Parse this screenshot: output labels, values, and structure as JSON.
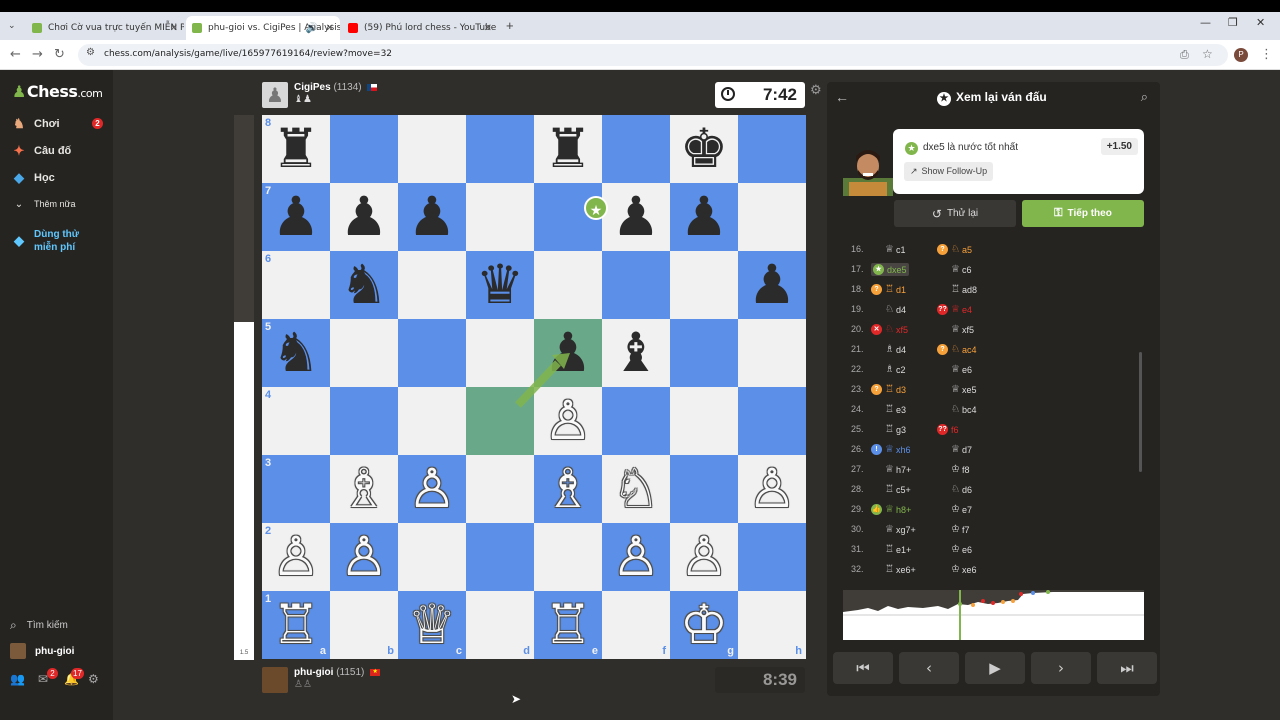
{
  "browser": {
    "tabs": [
      {
        "title": "Chơi Cờ vua trực tuyến MIỄN PHÍ",
        "favicon_color": "#81b64c",
        "active": false
      },
      {
        "title": "phu-gioi vs. CigiPes | Analysis",
        "favicon_color": "#81b64c",
        "active": true
      },
      {
        "title": "(59) Phú lord chess - YouTube",
        "favicon_color": "#ff0000",
        "active": false
      }
    ],
    "url": "chess.com/analysis/game/live/165977619164/review?move=32",
    "new_tab": "+",
    "profile_initial": "P"
  },
  "sidebar": {
    "logo_main": "Chess",
    "logo_suffix": ".com",
    "items": [
      {
        "label": "Chơi",
        "icon": "play-icon",
        "badge": "2"
      },
      {
        "label": "Câu đố",
        "icon": "puzzle-icon"
      },
      {
        "label": "Học",
        "icon": "learn-icon"
      },
      {
        "label": "Thêm nữa",
        "icon": "chevron-down-icon"
      }
    ],
    "trial_line1": "Dùng thử",
    "trial_line2": "miễn phí",
    "search_label": "Tìm kiếm",
    "username": "phu-gioi",
    "mail_badge": "2",
    "bell_badge": "17"
  },
  "players": {
    "top": {
      "name": "CigiPes",
      "rating": "(1134)",
      "captured": "♝♟",
      "clock": "7:42"
    },
    "bottom": {
      "name": "phu-gioi",
      "rating": "(1151)",
      "captured": "♙♙",
      "clock": "8:39"
    }
  },
  "eval_bar": {
    "label": "1.5",
    "white_fraction": 0.62
  },
  "board": {
    "files": [
      "a",
      "b",
      "c",
      "d",
      "e",
      "f",
      "g",
      "h"
    ],
    "ranks": [
      "8",
      "7",
      "6",
      "5",
      "4",
      "3",
      "2",
      "1"
    ],
    "highlight_from": "d4",
    "highlight_to": "e5",
    "pieces": [
      {
        "sq": "a8",
        "p": "♜",
        "c": "b"
      },
      {
        "sq": "e8",
        "p": "♜",
        "c": "b"
      },
      {
        "sq": "g8",
        "p": "♚",
        "c": "b"
      },
      {
        "sq": "a7",
        "p": "♟",
        "c": "b"
      },
      {
        "sq": "b7",
        "p": "♟",
        "c": "b"
      },
      {
        "sq": "c7",
        "p": "♟",
        "c": "b"
      },
      {
        "sq": "f7",
        "p": "♟",
        "c": "b"
      },
      {
        "sq": "g7",
        "p": "♟",
        "c": "b"
      },
      {
        "sq": "b6",
        "p": "♞",
        "c": "b"
      },
      {
        "sq": "d6",
        "p": "♛",
        "c": "b"
      },
      {
        "sq": "h6",
        "p": "♟",
        "c": "b"
      },
      {
        "sq": "a5",
        "p": "♞",
        "c": "b"
      },
      {
        "sq": "e5",
        "p": "♟",
        "c": "b"
      },
      {
        "sq": "f5",
        "p": "♝",
        "c": "b"
      },
      {
        "sq": "e4",
        "p": "♙",
        "c": "w"
      },
      {
        "sq": "b3",
        "p": "♗",
        "c": "w"
      },
      {
        "sq": "c3",
        "p": "♙",
        "c": "w"
      },
      {
        "sq": "e3",
        "p": "♗",
        "c": "w"
      },
      {
        "sq": "f3",
        "p": "♘",
        "c": "w"
      },
      {
        "sq": "h3",
        "p": "♙",
        "c": "w"
      },
      {
        "sq": "a2",
        "p": "♙",
        "c": "w"
      },
      {
        "sq": "b2",
        "p": "♙",
        "c": "w"
      },
      {
        "sq": "f2",
        "p": "♙",
        "c": "w"
      },
      {
        "sq": "g2",
        "p": "♙",
        "c": "w"
      },
      {
        "sq": "a1",
        "p": "♖",
        "c": "w"
      },
      {
        "sq": "c1",
        "p": "♕",
        "c": "w"
      },
      {
        "sq": "e1",
        "p": "♖",
        "c": "w"
      },
      {
        "sq": "g1",
        "p": "♔",
        "c": "w"
      }
    ],
    "light_color": "#f1f1f1",
    "dark_color": "#5b8fe8"
  },
  "review": {
    "title": "Xem lại ván đấu",
    "best_move_text": "dxe5 là nước tốt nhất",
    "eval": "+1.50",
    "follow_up": "Show Follow-Up",
    "retry": "Thử lại",
    "next": "Tiếp theo"
  },
  "moves": [
    {
      "n": "16.",
      "w": {
        "pc": "♕",
        "m": "c1"
      },
      "b": {
        "pc": "♘",
        "m": "a5",
        "ann": "?",
        "annc": "#f7a13a",
        "col": "#f7a13a"
      }
    },
    {
      "n": "17.",
      "w": {
        "m": "dxe5",
        "ann": "★",
        "annc": "#81b64c",
        "current": true,
        "col": "#81b64c"
      },
      "b": {
        "pc": "♕",
        "m": "c6"
      }
    },
    {
      "n": "18.",
      "w": {
        "pc": "♖",
        "m": "d1",
        "ann": "?",
        "annc": "#f7a13a",
        "col": "#f7a13a"
      },
      "b": {
        "pc": "♖",
        "m": "ad8"
      }
    },
    {
      "n": "19.",
      "w": {
        "pc": "♘",
        "m": "d4"
      },
      "b": {
        "pc": "♕",
        "m": "e4",
        "ann": "??",
        "annc": "#e02828",
        "col": "#e02828"
      }
    },
    {
      "n": "20.",
      "w": {
        "pc": "♘",
        "m": "xf5",
        "ann": "✕",
        "annc": "#e02828",
        "col": "#e02828"
      },
      "b": {
        "pc": "♕",
        "m": "xf5"
      }
    },
    {
      "n": "21.",
      "w": {
        "pc": "♗",
        "m": "d4"
      },
      "b": {
        "pc": "♘",
        "m": "ac4",
        "ann": "?",
        "annc": "#f7a13a",
        "col": "#f7a13a"
      }
    },
    {
      "n": "22.",
      "w": {
        "pc": "♗",
        "m": "c2"
      },
      "b": {
        "pc": "♕",
        "m": "e6"
      }
    },
    {
      "n": "23.",
      "w": {
        "pc": "♖",
        "m": "d3",
        "ann": "?",
        "annc": "#f7a13a",
        "col": "#f7a13a"
      },
      "b": {
        "pc": "♕",
        "m": "xe5"
      }
    },
    {
      "n": "24.",
      "w": {
        "pc": "♖",
        "m": "e3"
      },
      "b": {
        "pc": "♘",
        "m": "bc4"
      }
    },
    {
      "n": "25.",
      "w": {
        "pc": "♖",
        "m": "g3"
      },
      "b": {
        "m": "f6",
        "ann": "??",
        "annc": "#e02828",
        "col": "#e02828"
      }
    },
    {
      "n": "26.",
      "w": {
        "pc": "♕",
        "m": "xh6",
        "ann": "!",
        "annc": "#5b8fe8",
        "col": "#5b8fe8"
      },
      "b": {
        "pc": "♕",
        "m": "d7"
      }
    },
    {
      "n": "27.",
      "w": {
        "pc": "♕",
        "m": "h7+"
      },
      "b": {
        "pc": "♔",
        "m": "f8"
      }
    },
    {
      "n": "28.",
      "w": {
        "pc": "♖",
        "m": "c5+"
      },
      "b": {
        "pc": "♘",
        "m": "d6"
      }
    },
    {
      "n": "29.",
      "w": {
        "pc": "♕",
        "m": "h8+",
        "ann": "👍",
        "annc": "#81b64c",
        "col": "#81b64c"
      },
      "b": {
        "pc": "♔",
        "m": "e7"
      }
    },
    {
      "n": "30.",
      "w": {
        "pc": "♕",
        "m": "xg7+"
      },
      "b": {
        "pc": "♔",
        "m": "f7"
      }
    },
    {
      "n": "31.",
      "w": {
        "pc": "♖",
        "m": "e1+"
      },
      "b": {
        "pc": "♔",
        "m": "e6"
      }
    },
    {
      "n": "32.",
      "w": {
        "pc": "♖",
        "m": "xe6+"
      },
      "b": {
        "pc": "♔",
        "m": "xe6"
      }
    }
  ],
  "controls": [
    "⏮",
    "‹",
    "▶",
    "›",
    "⏭"
  ]
}
